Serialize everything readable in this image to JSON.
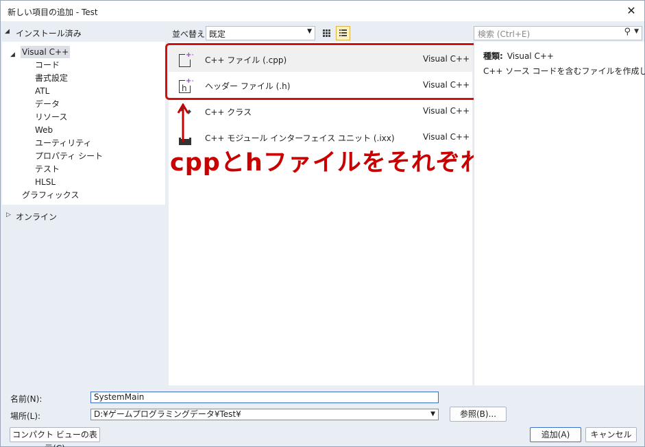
{
  "window": {
    "title": "新しい項目の追加 - Test",
    "close_glyph": "✕"
  },
  "left": {
    "header": "インストール済み",
    "tree": [
      {
        "label": "Visual C++",
        "level": 0,
        "selected": true
      },
      {
        "label": "コード",
        "level": 1
      },
      {
        "label": "書式設定",
        "level": 1
      },
      {
        "label": "ATL",
        "level": 1
      },
      {
        "label": "データ",
        "level": 1
      },
      {
        "label": "リソース",
        "level": 1
      },
      {
        "label": "Web",
        "level": 1
      },
      {
        "label": "ユーティリティ",
        "level": 1
      },
      {
        "label": "プロパティ シート",
        "level": 1
      },
      {
        "label": "テスト",
        "level": 1
      },
      {
        "label": "HLSL",
        "level": 1
      },
      {
        "label": "グラフィックス",
        "level": 0
      }
    ],
    "online": "オンライン"
  },
  "toolbar": {
    "sort_label": "並べ替え:",
    "sort_value": "既定",
    "search_placeholder": "検索 (Ctrl+E)"
  },
  "items": [
    {
      "name": "C++ ファイル (.cpp)",
      "lang": "Visual C++",
      "icon": "cpp-file-icon"
    },
    {
      "name": "ヘッダー ファイル (.h)",
      "lang": "Visual C++",
      "icon": "header-file-icon"
    },
    {
      "name": "C++ クラス",
      "lang": "Visual C++",
      "icon": "cpp-class-icon"
    },
    {
      "name": "C++ モジュール インターフェイス ユニット (.ixx)",
      "lang": "Visual C++",
      "icon": "module-icon"
    }
  ],
  "annotation": "cppとhファイルをそれぞれ追加",
  "details": {
    "type_label": "種類:",
    "type_value": "Visual C++",
    "description": "C++ ソース コードを含むファイルを作成します"
  },
  "form": {
    "name_label": "名前(N):",
    "name_value": "SystemMain",
    "location_label": "場所(L):",
    "location_value": "D:¥ゲームプログラミングデータ¥Test¥",
    "browse_label": "参照(B)...",
    "compact_label": "コンパクト ビューの表示(C)",
    "add_label": "追加(A)",
    "cancel_label": "キャンセル"
  },
  "colors": {
    "accent_red": "#d01010",
    "annotation_red": "#c80000",
    "selected_view_bg": "#fff3c4"
  }
}
